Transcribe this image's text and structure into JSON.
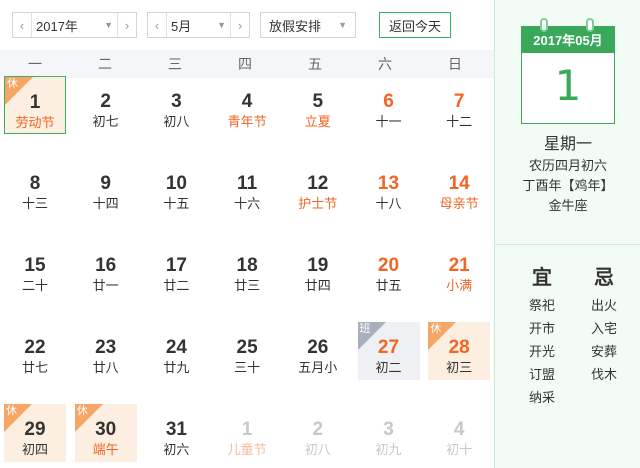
{
  "toolbar": {
    "year_label": "2017年",
    "month_label": "5月",
    "holiday_label": "放假安排",
    "today_label": "返回今天",
    "prev_icon": "‹",
    "next_icon": "›",
    "caret_icon": "▼"
  },
  "weekdays": [
    "一",
    "二",
    "三",
    "四",
    "五",
    "六",
    "日"
  ],
  "days": [
    {
      "num": "1",
      "lunar": "劳动节",
      "fest": true,
      "weekend": false,
      "mark": "休",
      "type": "holiday",
      "today": true,
      "other": false
    },
    {
      "num": "2",
      "lunar": "初七",
      "fest": false,
      "weekend": false,
      "mark": "",
      "type": "",
      "today": false,
      "other": false
    },
    {
      "num": "3",
      "lunar": "初八",
      "fest": false,
      "weekend": false,
      "mark": "",
      "type": "",
      "today": false,
      "other": false
    },
    {
      "num": "4",
      "lunar": "青年节",
      "fest": true,
      "weekend": false,
      "mark": "",
      "type": "",
      "today": false,
      "other": false
    },
    {
      "num": "5",
      "lunar": "立夏",
      "fest": true,
      "weekend": false,
      "mark": "",
      "type": "",
      "today": false,
      "other": false
    },
    {
      "num": "6",
      "lunar": "十一",
      "fest": false,
      "weekend": true,
      "mark": "",
      "type": "",
      "today": false,
      "other": false
    },
    {
      "num": "7",
      "lunar": "十二",
      "fest": false,
      "weekend": true,
      "mark": "",
      "type": "",
      "today": false,
      "other": false
    },
    {
      "num": "8",
      "lunar": "十三",
      "fest": false,
      "weekend": false,
      "mark": "",
      "type": "",
      "today": false,
      "other": false
    },
    {
      "num": "9",
      "lunar": "十四",
      "fest": false,
      "weekend": false,
      "mark": "",
      "type": "",
      "today": false,
      "other": false
    },
    {
      "num": "10",
      "lunar": "十五",
      "fest": false,
      "weekend": false,
      "mark": "",
      "type": "",
      "today": false,
      "other": false
    },
    {
      "num": "11",
      "lunar": "十六",
      "fest": false,
      "weekend": false,
      "mark": "",
      "type": "",
      "today": false,
      "other": false
    },
    {
      "num": "12",
      "lunar": "护士节",
      "fest": true,
      "weekend": false,
      "mark": "",
      "type": "",
      "today": false,
      "other": false
    },
    {
      "num": "13",
      "lunar": "十八",
      "fest": false,
      "weekend": true,
      "mark": "",
      "type": "",
      "today": false,
      "other": false
    },
    {
      "num": "14",
      "lunar": "母亲节",
      "fest": true,
      "weekend": true,
      "mark": "",
      "type": "",
      "today": false,
      "other": false
    },
    {
      "num": "15",
      "lunar": "二十",
      "fest": false,
      "weekend": false,
      "mark": "",
      "type": "",
      "today": false,
      "other": false
    },
    {
      "num": "16",
      "lunar": "廿一",
      "fest": false,
      "weekend": false,
      "mark": "",
      "type": "",
      "today": false,
      "other": false
    },
    {
      "num": "17",
      "lunar": "廿二",
      "fest": false,
      "weekend": false,
      "mark": "",
      "type": "",
      "today": false,
      "other": false
    },
    {
      "num": "18",
      "lunar": "廿三",
      "fest": false,
      "weekend": false,
      "mark": "",
      "type": "",
      "today": false,
      "other": false
    },
    {
      "num": "19",
      "lunar": "廿四",
      "fest": false,
      "weekend": false,
      "mark": "",
      "type": "",
      "today": false,
      "other": false
    },
    {
      "num": "20",
      "lunar": "廿五",
      "fest": false,
      "weekend": true,
      "mark": "",
      "type": "",
      "today": false,
      "other": false
    },
    {
      "num": "21",
      "lunar": "小满",
      "fest": true,
      "weekend": true,
      "mark": "",
      "type": "",
      "today": false,
      "other": false
    },
    {
      "num": "22",
      "lunar": "廿七",
      "fest": false,
      "weekend": false,
      "mark": "",
      "type": "",
      "today": false,
      "other": false
    },
    {
      "num": "23",
      "lunar": "廿八",
      "fest": false,
      "weekend": false,
      "mark": "",
      "type": "",
      "today": false,
      "other": false
    },
    {
      "num": "24",
      "lunar": "廿九",
      "fest": false,
      "weekend": false,
      "mark": "",
      "type": "",
      "today": false,
      "other": false
    },
    {
      "num": "25",
      "lunar": "三十",
      "fest": false,
      "weekend": false,
      "mark": "",
      "type": "",
      "today": false,
      "other": false
    },
    {
      "num": "26",
      "lunar": "五月小",
      "fest": false,
      "weekend": false,
      "mark": "",
      "type": "",
      "today": false,
      "other": false
    },
    {
      "num": "27",
      "lunar": "初二",
      "fest": false,
      "weekend": true,
      "mark": "班",
      "type": "work",
      "today": false,
      "other": false
    },
    {
      "num": "28",
      "lunar": "初三",
      "fest": false,
      "weekend": true,
      "mark": "休",
      "type": "holiday",
      "today": false,
      "other": false
    },
    {
      "num": "29",
      "lunar": "初四",
      "fest": false,
      "weekend": false,
      "mark": "休",
      "type": "holiday",
      "today": false,
      "other": false
    },
    {
      "num": "30",
      "lunar": "端午",
      "fest": true,
      "weekend": false,
      "mark": "休",
      "type": "holiday",
      "today": false,
      "other": false
    },
    {
      "num": "31",
      "lunar": "初六",
      "fest": false,
      "weekend": false,
      "mark": "",
      "type": "",
      "today": false,
      "other": false
    },
    {
      "num": "1",
      "lunar": "儿童节",
      "fest": true,
      "weekend": false,
      "mark": "",
      "type": "",
      "today": false,
      "other": true
    },
    {
      "num": "2",
      "lunar": "初八",
      "fest": false,
      "weekend": false,
      "mark": "",
      "type": "",
      "today": false,
      "other": true
    },
    {
      "num": "3",
      "lunar": "初九",
      "fest": false,
      "weekend": true,
      "mark": "",
      "type": "",
      "today": false,
      "other": true
    },
    {
      "num": "4",
      "lunar": "初十",
      "fest": false,
      "weekend": true,
      "mark": "",
      "type": "",
      "today": false,
      "other": true
    }
  ],
  "detail": {
    "header": "2017年05月",
    "day": "1",
    "weekday": "星期一",
    "lunar_date": "农历四月初六",
    "ganzhi": "丁酉年【鸡年】",
    "constellation": "金牛座"
  },
  "yi": {
    "title": "宜",
    "items": [
      "祭祀",
      "开市",
      "开光",
      "订盟",
      "纳采"
    ]
  },
  "ji": {
    "title": "忌",
    "items": [
      "出火",
      "入宅",
      "安葬",
      "伐木"
    ]
  },
  "colors": {
    "accent": "#3aa85b",
    "festival": "#f26522",
    "holiday_bg": "#fdeee2",
    "work_bg": "#eef0f3"
  }
}
